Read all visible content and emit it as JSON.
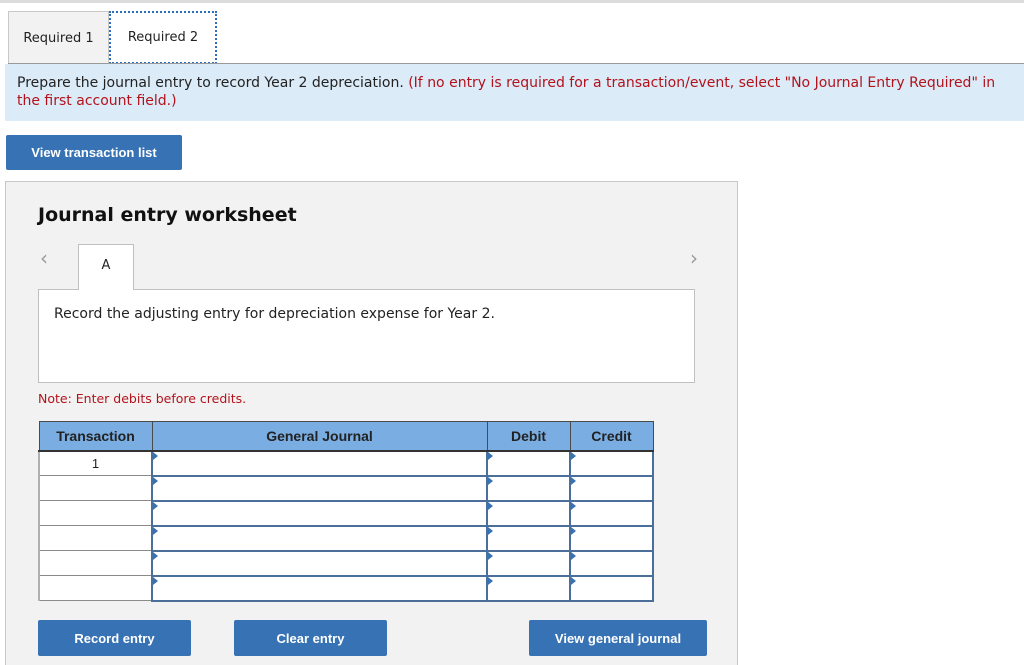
{
  "tabs": [
    {
      "label": "Required 1",
      "active": false
    },
    {
      "label": "Required 2",
      "active": true
    }
  ],
  "instruction": {
    "main": "Prepare the journal entry to record Year 2 depreciation.",
    "note": "(If no entry is required for a transaction/event, select \"No Journal Entry Required\" in the first account field.)"
  },
  "buttons": {
    "view_transaction_list": "View transaction list",
    "record_entry": "Record entry",
    "clear_entry": "Clear entry",
    "view_general_journal": "View general journal"
  },
  "worksheet": {
    "title": "Journal entry worksheet",
    "nav_prev_icon": "chevron-left",
    "nav_next_icon": "chevron-right",
    "entry_tab": "A",
    "description": "Record the adjusting entry for depreciation expense for Year 2.",
    "note": "Note: Enter debits before credits."
  },
  "journal": {
    "headers": [
      "Transaction",
      "General Journal",
      "Debit",
      "Credit"
    ],
    "rows": [
      {
        "transaction": "1",
        "account": "",
        "debit": "",
        "credit": ""
      },
      {
        "transaction": "",
        "account": "",
        "debit": "",
        "credit": ""
      },
      {
        "transaction": "",
        "account": "",
        "debit": "",
        "credit": ""
      },
      {
        "transaction": "",
        "account": "",
        "debit": "",
        "credit": ""
      },
      {
        "transaction": "",
        "account": "",
        "debit": "",
        "credit": ""
      },
      {
        "transaction": "",
        "account": "",
        "debit": "",
        "credit": ""
      }
    ]
  },
  "colors": {
    "button_blue": "#3772b4",
    "header_blue": "#7aaee2",
    "banner_bg": "#dbebf8",
    "alert_red": "#b3121b"
  }
}
